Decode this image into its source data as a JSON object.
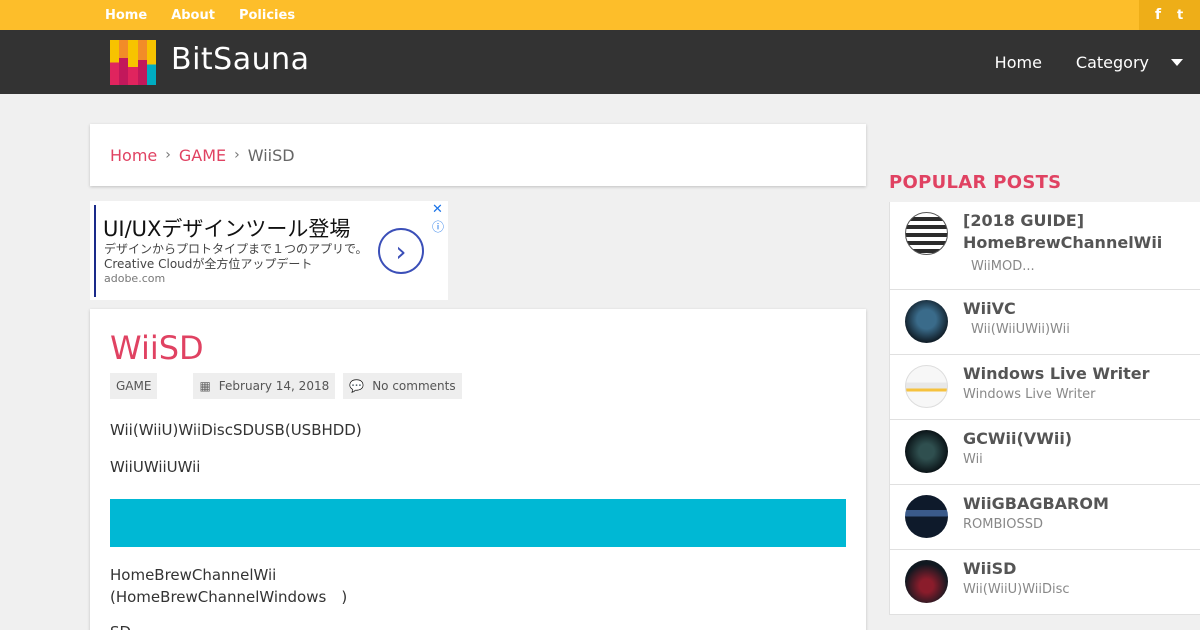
{
  "topnav": {
    "home": "Home",
    "about": "About",
    "policies": "Policies"
  },
  "social": {
    "facebook": "f",
    "twitter": "t"
  },
  "header": {
    "title": "BitSauna",
    "nav": {
      "home": "Home",
      "category": "Category"
    },
    "logo_colors": [
      "#f7c300",
      "#f28c28",
      "#e0245e",
      "#c2185b",
      "#00acc1"
    ]
  },
  "breadcrumb": {
    "home": "Home",
    "category": "GAME",
    "current": "WiiSD"
  },
  "ad": {
    "title": "UI/UXデザインツール登場",
    "desc_line1": "デザインからプロトタイプまで１つのアプリで。",
    "desc_line2": "Creative Cloudが全方位アップデート",
    "url": "adobe.com",
    "close": "✕",
    "info": "ⓘ",
    "arrow": "›"
  },
  "article": {
    "title": "WiiSD",
    "category": "GAME",
    "date": "February 14, 2018",
    "comments": "No comments",
    "para1": "Wii(WiiU)WiiDiscSDUSB(USBHDD)",
    "para2": "WiiUWiiUWii",
    "para3_line1": "HomeBrewChannelWii",
    "para3_line2": "(HomeBrewChannelWindows　)",
    "para4": "SD",
    "accent_color": "#e04262",
    "banner_color": "#00b8d4"
  },
  "sidebar": {
    "heading": "POPULAR POSTS",
    "items": [
      {
        "title": "[2018 GUIDE] HomeBrewChannelWii",
        "sub": "WiiMOD..."
      },
      {
        "title": "WiiVC",
        "sub": "Wii(WiiUWii)Wii"
      },
      {
        "title": "Windows Live Writer",
        "sub": "Windows Live Writer"
      },
      {
        "title": "GCWii(VWii)",
        "sub": "Wii"
      },
      {
        "title": "WiiGBAGBAROM",
        "sub": "ROMBIOSSD"
      },
      {
        "title": "WiiSD",
        "sub": "Wii(WiiU)WiiDisc"
      }
    ]
  }
}
